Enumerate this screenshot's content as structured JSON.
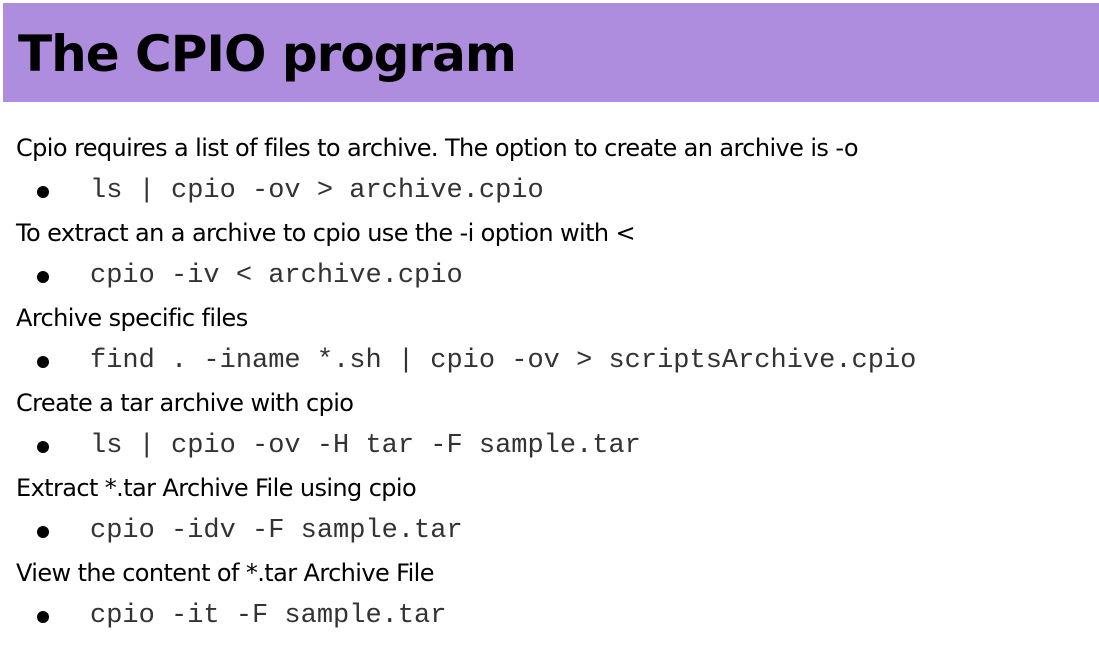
{
  "title": "The CPIO program",
  "items": [
    {
      "text": "Cpio requires a list of files to archive. The option to create an archive is -o",
      "command": "ls | cpio -ov > archive.cpio"
    },
    {
      "text": "To extract an a archive to cpio use the -i option with <",
      "command": "cpio -iv < archive.cpio"
    },
    {
      "text": "Archive specific files",
      "command": "find . -iname *.sh | cpio -ov > scriptsArchive.cpio"
    },
    {
      "text": "Create a tar archive with cpio",
      "command": "ls | cpio -ov -H tar -F sample.tar"
    },
    {
      "text": "Extract *.tar Archive File using cpio",
      "command": "cpio -idv -F sample.tar"
    },
    {
      "text": "View the content of *.tar Archive File",
      "command": "cpio -it -F sample.tar"
    }
  ],
  "colors": {
    "title_bar": "#ae8ddf",
    "text": "#000000",
    "code": "#333333"
  }
}
